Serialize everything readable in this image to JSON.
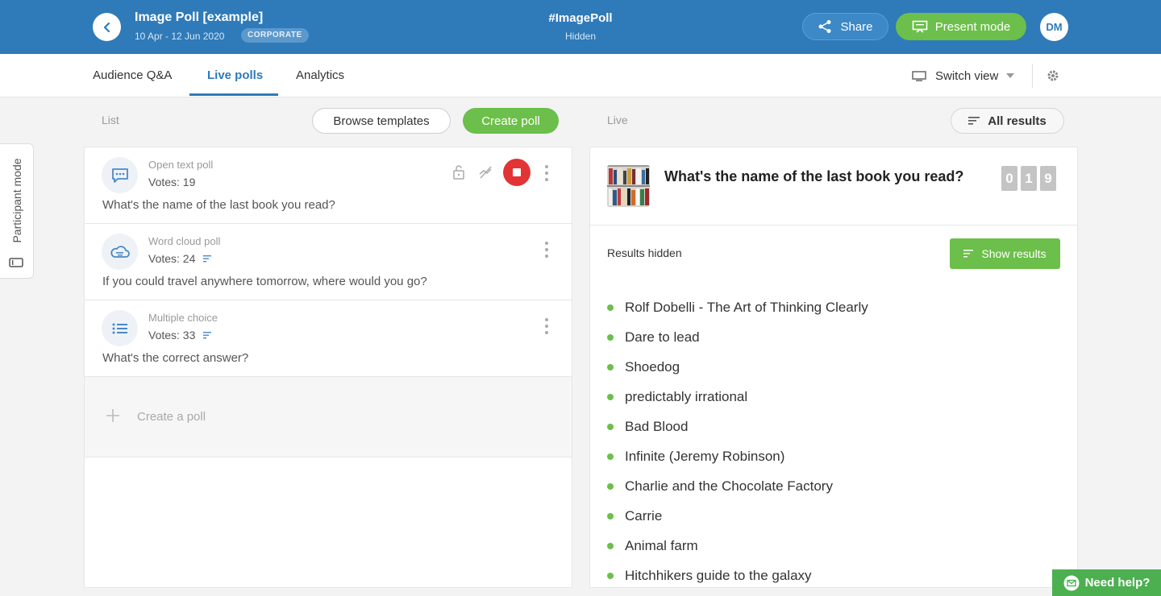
{
  "header": {
    "event_title": "Image Poll [example]",
    "event_dates": "10 Apr - 12 Jun 2020",
    "plan_badge": "CORPORATE",
    "event_code": "#ImagePoll",
    "event_status": "Hidden",
    "share_label": "Share",
    "present_label": "Present mode",
    "avatar_initials": "DM"
  },
  "tabs": {
    "items": [
      {
        "label": "Audience Q&A"
      },
      {
        "label": "Live polls",
        "active": true
      },
      {
        "label": "Analytics"
      }
    ],
    "switch_view_label": "Switch view"
  },
  "toolbar": {
    "list_label": "List",
    "browse_templates_label": "Browse templates",
    "create_poll_label": "Create poll",
    "live_label": "Live",
    "all_results_label": "All results"
  },
  "side_tab": {
    "label": "Participant mode"
  },
  "polls": [
    {
      "type": "Open text poll",
      "votes": "Votes: 19",
      "question": "What's the name of the last book you read?",
      "icon": "chat-icon"
    },
    {
      "type": "Word cloud poll",
      "votes": "Votes: 24",
      "question": "If you could travel anywhere tomorrow, where would you go?",
      "icon": "cloud-icon"
    },
    {
      "type": "Multiple choice",
      "votes": "Votes: 33",
      "question": "What's the correct answer?",
      "icon": "list-icon"
    }
  ],
  "create_a_poll_label": "Create a poll",
  "live": {
    "question": "What's the name of the last book you read?",
    "vote_counter": [
      "0",
      "1",
      "9"
    ],
    "results_hidden_label": "Results hidden",
    "show_results_label": "Show results",
    "answers": [
      "Rolf Dobelli - The Art of Thinking Clearly",
      "Dare to lead",
      "Shoedog",
      "predictably irrational",
      "Bad Blood",
      "Infinite (Jeremy Robinson)",
      "Charlie and the Chocolate Factory",
      "Carrie",
      "Animal farm",
      "Hitchhikers guide to the galaxy"
    ]
  },
  "help_label": "Need help?",
  "colors": {
    "header_blue": "#2f7ab9",
    "accent_green": "#6cbf4a",
    "stop_red": "#e23434"
  }
}
